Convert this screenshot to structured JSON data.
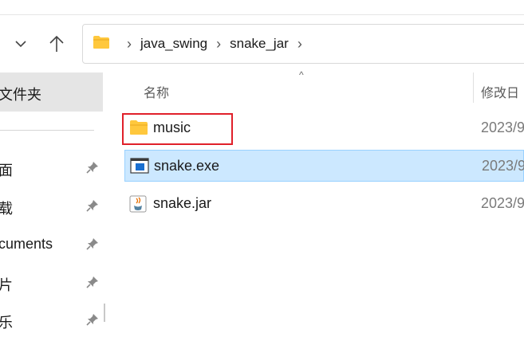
{
  "address_bar": {
    "crumbs": [
      "java_swing",
      "snake_jar"
    ]
  },
  "sidebar": {
    "selected": "文件夹",
    "items": [
      {
        "label": "面",
        "pinned": true
      },
      {
        "label": "载",
        "pinned": true
      },
      {
        "label": "cuments",
        "pinned": true
      },
      {
        "label": "片",
        "pinned": true
      },
      {
        "label": "乐",
        "pinned": true
      }
    ]
  },
  "columns": {
    "name": "名称",
    "modified": "修改日"
  },
  "files": [
    {
      "name": "music",
      "icon": "folder-icon",
      "modified": "2023/9"
    },
    {
      "name": "snake.exe",
      "icon": "exe-icon",
      "modified": "2023/9",
      "selected": true
    },
    {
      "name": "snake.jar",
      "icon": "java-jar-icon",
      "modified": "2023/9"
    }
  ],
  "colors": {
    "selection": "#cce8ff",
    "selection_border": "#99d1ff",
    "annotation": "#e0202a",
    "folder": "#ffc83d"
  }
}
